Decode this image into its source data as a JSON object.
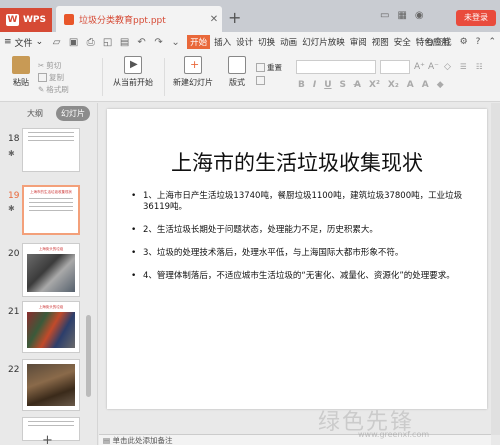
{
  "titlebar": {
    "app_label": "WPS",
    "doc_tab_label": "垃圾分类教育ppt.ppt",
    "login_label": "未登录"
  },
  "menubar": {
    "file_label": "文件",
    "tabs": [
      "开始",
      "插入",
      "设计",
      "切换",
      "动画",
      "幻灯片放映",
      "审阅",
      "视图",
      "安全",
      "特色应用"
    ],
    "search_label": "Q查找"
  },
  "ribbon": {
    "paste": "粘贴",
    "cut": "剪切",
    "copy": "复制",
    "format_painter": "格式刷",
    "from_current": "从当前开始",
    "new_slide": "新建幻灯片",
    "layout": "版式",
    "reset": "重置"
  },
  "leftpanel": {
    "tab_outline": "大纲",
    "tab_slides": "幻灯片",
    "slide_numbers": [
      "18",
      "19",
      "20",
      "21",
      "22"
    ],
    "thumb_titles": [
      "",
      "上海市的生活垃圾收集现状",
      "上海街头的垃圾",
      "上海街头的垃圾",
      ""
    ]
  },
  "slide": {
    "title": "上海市的生活垃圾收集现状",
    "bullets": [
      "1、上海市日产生活垃圾13740吨，餐厨垃圾1100吨，建筑垃圾37800吨，工业垃圾36119吨。",
      "2、生活垃圾长期处于问题状态，处理能力不足，历史积累大。",
      "3、垃圾的处理技术落后，处理水平低，与上海国际大都市形象不符。",
      "4、管理体制落后，不适应城市生活垃圾的“无害化、减量化、资源化”的处理要求。"
    ]
  },
  "notes": {
    "placeholder": "单击此处添加备注"
  },
  "watermark": {
    "text": "绿色先锋",
    "url": "www.greenxf.com"
  },
  "colors": {
    "accent": "#e9683a",
    "wps_red": "#d64a35"
  }
}
